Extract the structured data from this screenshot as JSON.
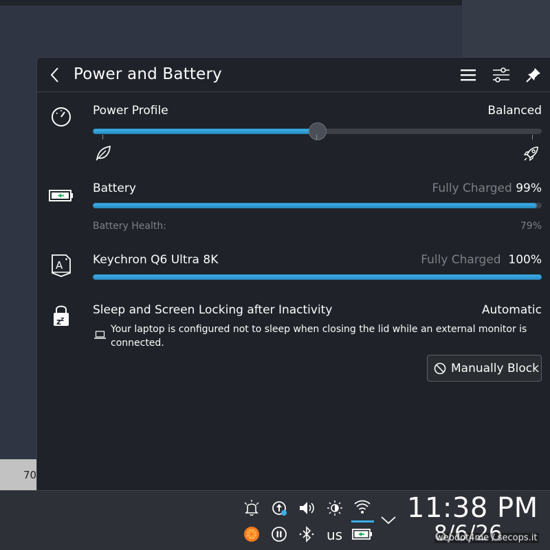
{
  "background": {
    "partial_text": "70"
  },
  "header": {
    "title": "Power and Battery"
  },
  "power_profile": {
    "label": "Power Profile",
    "value": "Balanced",
    "slider_position": 0.5,
    "left_icon": "leaf-icon",
    "right_icon": "rocket-icon"
  },
  "battery": {
    "label": "Battery",
    "status": "Fully Charged",
    "percent": "99%",
    "level": 0.99,
    "health_label": "Battery Health:",
    "health_value": "79%"
  },
  "keyboard": {
    "label": "Keychron Q6 Ultra 8K",
    "status": "Fully Charged",
    "percent": "100%",
    "level": 1.0
  },
  "sleep": {
    "label": "Sleep and Screen Locking after Inactivity",
    "value": "Automatic",
    "note": "Your laptop is configured not to sleep when closing the lid while an external monitor is connected.",
    "button_label": "Manually Block"
  },
  "panel": {
    "keyboard_layout": "us",
    "time": "11:38 PM",
    "date": "8/6/26",
    "watermark": "webdot4me / secops.it"
  },
  "colors": {
    "accent": "#3daee9",
    "popup_bg": "#1f2329",
    "panel_bg": "#2d3036"
  }
}
